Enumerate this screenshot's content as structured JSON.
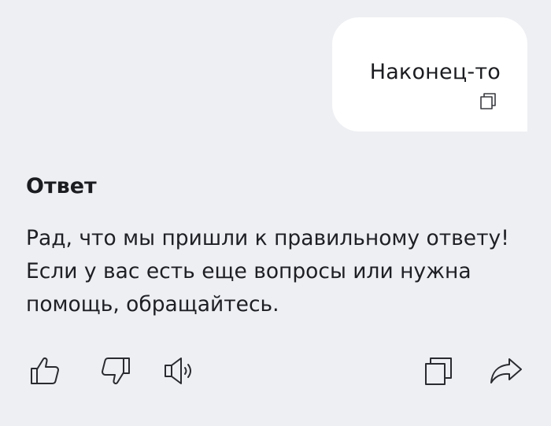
{
  "user_message": {
    "text": "Наконец-то"
  },
  "answer": {
    "heading": "Ответ",
    "text": "Рад, что мы пришли к правильному ответу! Если у вас есть еще вопросы или нужна помощь, обращайтесь."
  },
  "icons": {
    "bubble_copy": "copy-icon",
    "like": "thumbs-up-icon",
    "dislike": "thumbs-down-icon",
    "speak": "speaker-icon",
    "copy": "copy-icon",
    "share": "share-icon"
  },
  "colors": {
    "background": "#eeeff3",
    "bubble": "#ffffff",
    "text": "#1b1c20",
    "icon": "#2a2b30"
  }
}
